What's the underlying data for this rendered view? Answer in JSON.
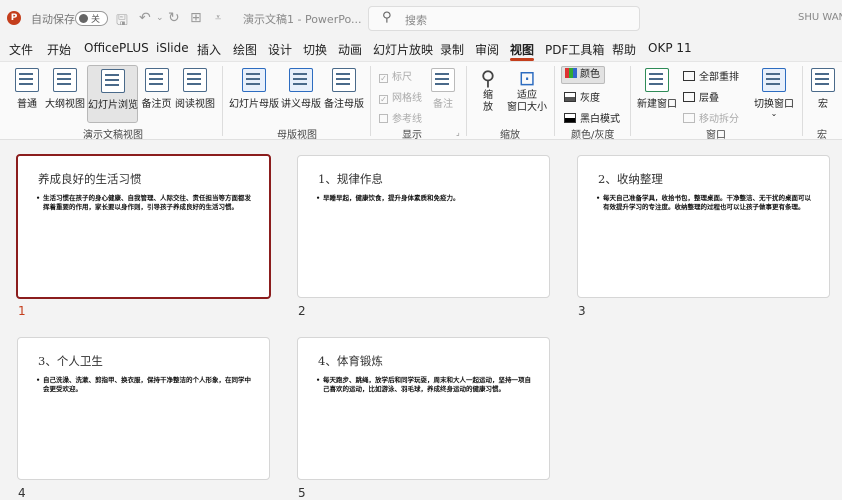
{
  "titlebar": {
    "app_logo": "P",
    "autosave_label": "自动保存",
    "autosave_state": "关",
    "doc_title": "演示文稿1 - PowerPo...",
    "search_placeholder": "搜索",
    "user_name": "SHU WAN"
  },
  "menu_tabs": [
    "文件",
    "开始",
    "OfficePLUS",
    "iSlide",
    "插入",
    "绘图",
    "设计",
    "切换",
    "动画",
    "幻灯片放映",
    "录制",
    "审阅",
    "视图",
    "PDF工具箱",
    "帮助",
    "OKP 11"
  ],
  "active_tab": "视图",
  "ribbon": {
    "presentation_views": {
      "label": "演示文稿视图",
      "buttons": [
        "普通",
        "大纲视图",
        "幻灯片浏览",
        "备注页",
        "阅读视图"
      ],
      "selected": "幻灯片浏览"
    },
    "master_views": {
      "label": "母版视图",
      "buttons": [
        "幻灯片母版",
        "讲义母版",
        "备注母版"
      ]
    },
    "show": {
      "label": "显示",
      "checkboxes": [
        "标尺",
        "网格线",
        "参考线"
      ],
      "notes": "备注"
    },
    "zoom": {
      "label": "缩放",
      "zoom_button_line1": "缩",
      "zoom_button_line2": "放",
      "fit_line1": "适应",
      "fit_line2": "窗口大小"
    },
    "color_grayscale": {
      "label": "颜色/灰度",
      "buttons": [
        "颜色",
        "灰度",
        "黑白模式"
      ]
    },
    "window": {
      "label": "窗口",
      "new_window": "新建窗口",
      "arrange_all": "全部重排",
      "cascade": "层叠",
      "move_split": "移动拆分",
      "switch_windows": "切换窗口"
    },
    "macros": {
      "label": "宏",
      "button": "宏"
    }
  },
  "slides": [
    {
      "number": "1",
      "title": "养成良好的生活习惯",
      "body": "生活习惯在孩子的身心健康、自我管理、人际交往、责任担当等方面都发挥着重要的作用，家长要以身作则，引导孩子养成良好的生活习惯。",
      "selected": true
    },
    {
      "number": "2",
      "title": "1、规律作息",
      "body": "早睡早起，健康饮食，提升身体素质和免疫力。",
      "selected": false
    },
    {
      "number": "3",
      "title": "2、收纳整理",
      "body": "每天自己准备学具，收拾书包，整理桌面。干净整洁、无干扰的桌面可以有效提升学习的专注度。收纳整理的过程也可以让孩子做事更有条理。",
      "selected": false
    },
    {
      "number": "4",
      "title": "3、个人卫生",
      "body": "自己洗澡、洗漱、剪指甲、换衣服，保持干净整洁的个人形象，在同学中会更受欢迎。",
      "selected": false
    },
    {
      "number": "5",
      "title": "4、体育锻炼",
      "body": "每天跑步、跳绳，放学后和同学玩耍，周末和大人一起运动，坚持一项自己喜欢的运动，比如游泳、羽毛球，养成终身运动的健康习惯。",
      "selected": false
    }
  ]
}
